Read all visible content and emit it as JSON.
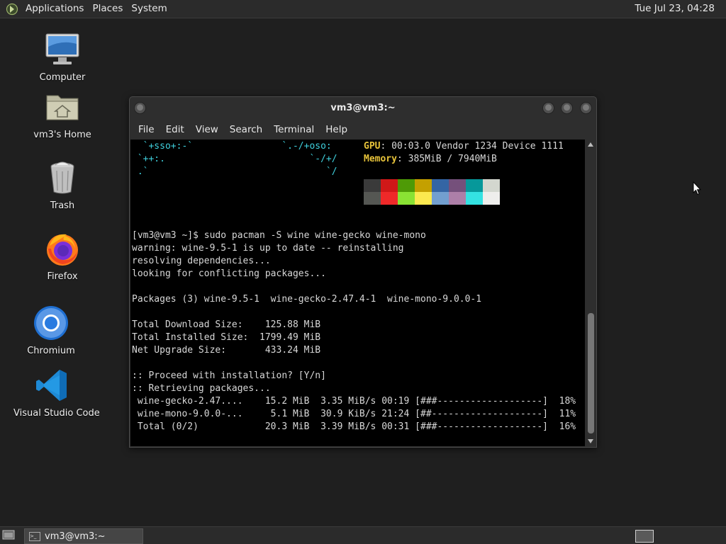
{
  "top_panel": {
    "menus": [
      "Applications",
      "Places",
      "System"
    ],
    "clock": "Tue Jul 23, 04:28"
  },
  "desktop_icons": [
    {
      "label": "Computer",
      "icon": "computer-icon"
    },
    {
      "label": "vm3's Home",
      "icon": "home-folder-icon"
    },
    {
      "label": "Trash",
      "icon": "trash-icon"
    },
    {
      "label": "Firefox",
      "icon": "firefox-icon"
    },
    {
      "label": "Chromium",
      "icon": "chromium-icon"
    },
    {
      "label": "Visual Studio Code",
      "icon": "vscode-icon"
    }
  ],
  "terminal": {
    "title": "vm3@vm3:~",
    "menu": [
      "File",
      "Edit",
      "View",
      "Search",
      "Terminal",
      "Help"
    ],
    "art": [
      "  `+sso+:-`                `.-/+oso:",
      " `++:.                          `-/+/",
      " .`                                `/"
    ],
    "gpu_label": "GPU",
    "gpu_value": ": 00:03.0 Vendor 1234 Device 1111",
    "memory_label": "Memory",
    "memory_value": ": 385MiB / 7940MiB",
    "palette_top": [
      "#3a3a3a",
      "#d01818",
      "#4e9a06",
      "#c4a000",
      "#3465a4",
      "#75507b",
      "#06989a",
      "#d3d7cf"
    ],
    "palette_bottom": [
      "#555753",
      "#ef2929",
      "#8ae234",
      "#fce94f",
      "#729fcf",
      "#ad7fa8",
      "#34e2e2",
      "#eeeeec"
    ],
    "lines": [
      "[vm3@vm3 ~]$ sudo pacman -S wine wine-gecko wine-mono",
      "warning: wine-9.5-1 is up to date -- reinstalling",
      "resolving dependencies...",
      "looking for conflicting packages...",
      "",
      "Packages (3) wine-9.5-1  wine-gecko-2.47.4-1  wine-mono-9.0.0-1",
      "",
      "Total Download Size:    125.88 MiB",
      "Total Installed Size:  1799.49 MiB",
      "Net Upgrade Size:       433.24 MiB",
      "",
      ":: Proceed with installation? [Y/n]",
      ":: Retrieving packages...",
      " wine-gecko-2.47....    15.2 MiB  3.35 MiB/s 00:19 [###-------------------]  18%",
      " wine-mono-9.0.0-...     5.1 MiB  30.9 KiB/s 21:24 [##--------------------]  11%",
      " Total (0/2)            20.3 MiB  3.39 MiB/s 00:31 [###-------------------]  16%"
    ]
  },
  "taskbar": {
    "task_label": "vm3@vm3:~"
  }
}
